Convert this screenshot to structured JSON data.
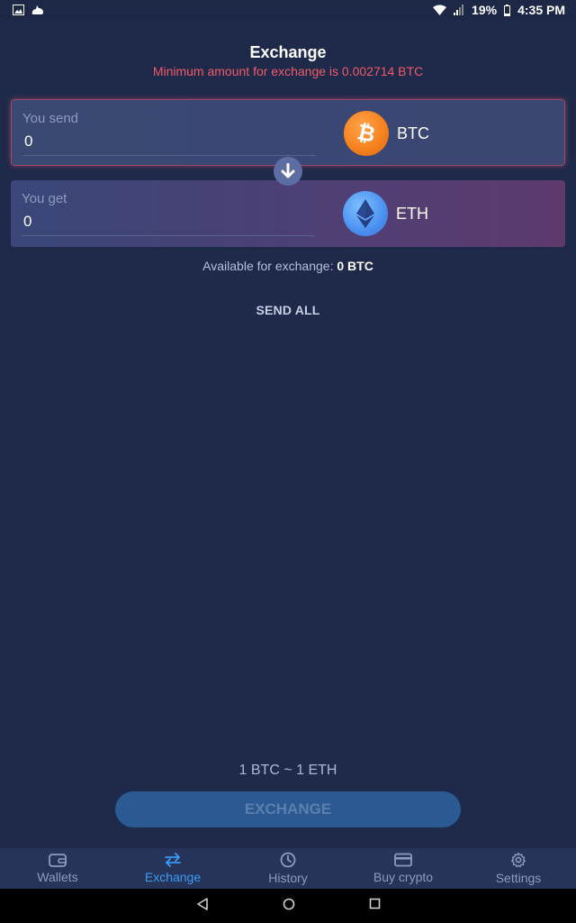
{
  "status_bar": {
    "battery": "19%",
    "time": "4:35 PM"
  },
  "header": {
    "title": "Exchange",
    "min_warning": "Minimum amount for exchange is 0.002714 BTC"
  },
  "send": {
    "label": "You send",
    "value": "0",
    "symbol": "BTC",
    "icon": "bitcoin-icon"
  },
  "get": {
    "label": "You get",
    "value": "0",
    "symbol": "ETH",
    "icon": "ethereum-icon"
  },
  "available": {
    "label": "Available for exchange:",
    "value": "0 BTC"
  },
  "send_all_label": "SEND ALL",
  "rate": "1 BTC ~ 1 ETH",
  "exchange_button_label": "EXCHANGE",
  "tabs": [
    {
      "label": "Wallets",
      "icon": "wallet-icon",
      "active": false
    },
    {
      "label": "Exchange",
      "icon": "swap-arrows-icon",
      "active": true
    },
    {
      "label": "History",
      "icon": "clock-icon",
      "active": false
    },
    {
      "label": "Buy crypto",
      "icon": "credit-card-icon",
      "active": false
    },
    {
      "label": "Settings",
      "icon": "gear-icon",
      "active": false
    }
  ],
  "colors": {
    "background": "#1f2a4b",
    "warning": "#ef5a66",
    "accent": "#3b9bf5",
    "btc": "#f5831f",
    "eth": "#4a90f0"
  }
}
